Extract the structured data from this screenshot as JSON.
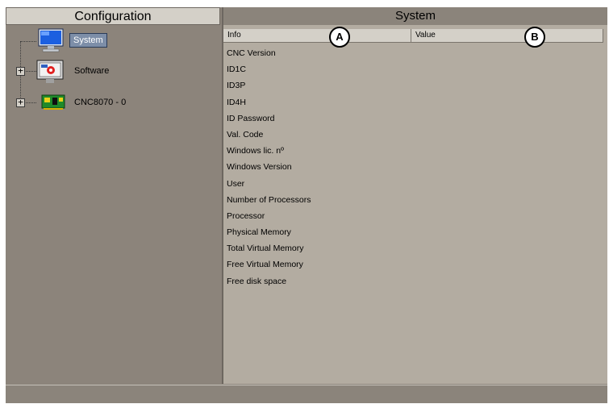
{
  "configuration_panel": {
    "title": "Configuration",
    "tree": [
      {
        "label": "System",
        "selected": true,
        "expandable": false,
        "icon": "monitor-icon"
      },
      {
        "label": "Software",
        "selected": false,
        "expandable": true,
        "icon": "software-icon"
      },
      {
        "label": "CNC8070 - 0",
        "selected": false,
        "expandable": true,
        "icon": "circuit-board-icon"
      }
    ],
    "expander_symbol": "+"
  },
  "system_panel": {
    "title": "System",
    "columns": {
      "info": "Info",
      "value": "Value"
    },
    "callouts": {
      "a": "A",
      "b": "B"
    },
    "rows": [
      "CNC Version",
      "ID1C",
      "ID3P",
      "ID4H",
      "ID Password",
      "Val. Code",
      "Windows lic. nº",
      "Windows Version",
      "User",
      "Number of Processors",
      "Processor",
      "Physical Memory",
      "Total Virtual Memory",
      "Free Virtual Memory",
      "Free disk space"
    ]
  },
  "colors": {
    "background": "#8c847b",
    "table": "#b3aca1",
    "selection": "#7d8ea8"
  }
}
